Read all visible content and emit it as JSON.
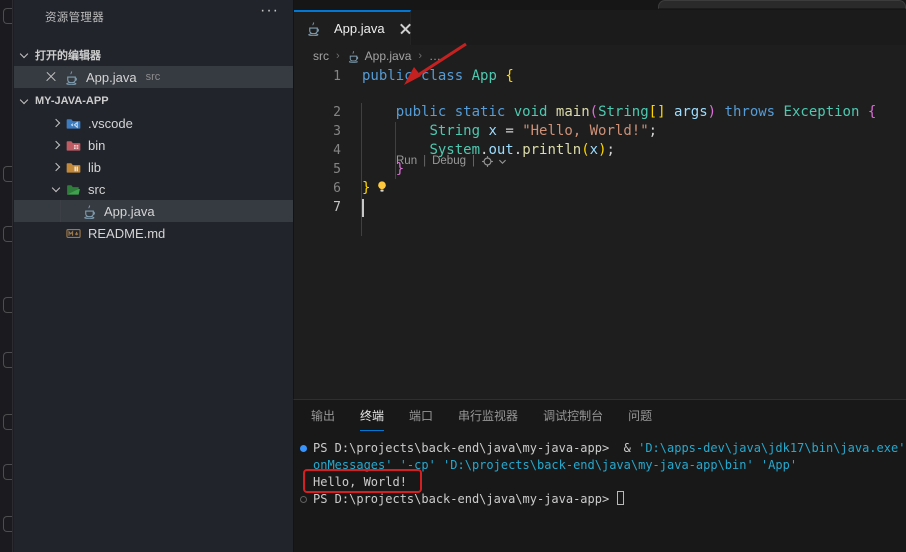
{
  "colors": {
    "accent_blue": "#0078d4",
    "annotation_red": "#d42020",
    "terminal_cyan": "#27a8cd",
    "selection_row": "#363a41"
  },
  "sidebar": {
    "title": "资源管理器",
    "more_icon": "···",
    "open_editors": {
      "label": "打开的编辑器",
      "file": {
        "name": "App.java",
        "detail": "src"
      }
    },
    "project": {
      "label": "MY-JAVA-APP",
      "items": [
        {
          "name": ".vscode",
          "icon": "folder-vscode",
          "chevron": "right",
          "indent": 1,
          "selected": false
        },
        {
          "name": "bin",
          "icon": "folder-bin",
          "chevron": "right",
          "indent": 1,
          "selected": false
        },
        {
          "name": "lib",
          "icon": "folder-lib",
          "chevron": "right",
          "indent": 1,
          "selected": false
        },
        {
          "name": "src",
          "icon": "folder-src",
          "chevron": "down",
          "indent": 1,
          "selected": false
        },
        {
          "name": "App.java",
          "icon": "file-java",
          "chevron": "none",
          "indent": 2,
          "selected": true
        },
        {
          "name": "README.md",
          "icon": "file-markdown",
          "chevron": "none",
          "indent": 1,
          "selected": false
        }
      ]
    }
  },
  "editor": {
    "tab": {
      "label": "App.java"
    },
    "breadcrumb": {
      "items": [
        "src",
        "App.java",
        "…"
      ]
    },
    "codelens": {
      "run_label": "Run",
      "debug_label": "Debug",
      "separator": "|"
    },
    "lines": [
      {
        "num": 1,
        "lens": true,
        "tokens": [
          {
            "t": "public",
            "c": "kw"
          },
          {
            "t": " ",
            "c": "fg"
          },
          {
            "t": "class",
            "c": "kw"
          },
          {
            "t": " ",
            "c": "fg"
          },
          {
            "t": "App",
            "c": "type"
          },
          {
            "t": " ",
            "c": "fg"
          },
          {
            "t": "{",
            "c": "b1"
          }
        ]
      },
      {
        "num": 2,
        "tokens": [
          {
            "t": "    ",
            "c": "fg"
          },
          {
            "t": "public",
            "c": "kw"
          },
          {
            "t": " ",
            "c": "fg"
          },
          {
            "t": "static",
            "c": "kw"
          },
          {
            "t": " ",
            "c": "fg"
          },
          {
            "t": "void",
            "c": "type"
          },
          {
            "t": " ",
            "c": "fg"
          },
          {
            "t": "main",
            "c": "fn"
          },
          {
            "t": "(",
            "c": "b2"
          },
          {
            "t": "String",
            "c": "type"
          },
          {
            "t": "[]",
            "c": "b1"
          },
          {
            "t": " ",
            "c": "fg"
          },
          {
            "t": "args",
            "c": "var"
          },
          {
            "t": ")",
            "c": "b2"
          },
          {
            "t": " ",
            "c": "fg"
          },
          {
            "t": "throws",
            "c": "kw"
          },
          {
            "t": " ",
            "c": "fg"
          },
          {
            "t": "Exception",
            "c": "type"
          },
          {
            "t": " ",
            "c": "fg"
          },
          {
            "t": "{",
            "c": "b2"
          }
        ]
      },
      {
        "num": 3,
        "tokens": [
          {
            "t": "        ",
            "c": "fg"
          },
          {
            "t": "String",
            "c": "type"
          },
          {
            "t": " ",
            "c": "fg"
          },
          {
            "t": "x",
            "c": "var"
          },
          {
            "t": " = ",
            "c": "fg"
          },
          {
            "t": "\"Hello, World!\"",
            "c": "str"
          },
          {
            "t": ";",
            "c": "fg"
          }
        ]
      },
      {
        "num": 4,
        "tokens": [
          {
            "t": "        ",
            "c": "fg"
          },
          {
            "t": "System",
            "c": "type"
          },
          {
            "t": ".",
            "c": "fg"
          },
          {
            "t": "out",
            "c": "var"
          },
          {
            "t": ".",
            "c": "fg"
          },
          {
            "t": "println",
            "c": "fn"
          },
          {
            "t": "(",
            "c": "b1"
          },
          {
            "t": "x",
            "c": "var"
          },
          {
            "t": ")",
            "c": "b1"
          },
          {
            "t": ";",
            "c": "fg"
          }
        ]
      },
      {
        "num": 5,
        "tokens": [
          {
            "t": "    ",
            "c": "fg"
          },
          {
            "t": "}",
            "c": "b2"
          }
        ]
      },
      {
        "num": 6,
        "lightbulb": true,
        "tokens": [
          {
            "t": "}",
            "c": "b1"
          }
        ]
      },
      {
        "num": 7,
        "cursor": true,
        "tokens": []
      }
    ]
  },
  "panel": {
    "tabs": [
      {
        "label": "输出",
        "active": false
      },
      {
        "label": "终端",
        "active": true
      },
      {
        "label": "端口",
        "active": false
      },
      {
        "label": "串行监视器",
        "active": false
      },
      {
        "label": "调试控制台",
        "active": false
      },
      {
        "label": "问题",
        "active": false
      }
    ],
    "terminal": {
      "lines": [
        {
          "decoration": "success",
          "segments": [
            {
              "t": "PS D:\\projects\\back-end\\java\\my-java-app>  & ",
              "c": "fg"
            },
            {
              "t": "'D:\\apps-dev\\java\\jdk17\\bin\\java.exe'",
              "c": "cyan"
            },
            {
              "t": " ",
              "c": "fg"
            },
            {
              "t": "'-",
              "c": "cyan"
            }
          ]
        },
        {
          "segments": [
            {
              "t": "onMessages' '-cp' 'D:\\projects\\back-end\\java\\my-java-app\\bin' 'App'",
              "c": "cyan"
            }
          ]
        },
        {
          "highlight": true,
          "segments": [
            {
              "t": "Hello, World!",
              "c": "fg"
            }
          ]
        },
        {
          "decoration": "pending",
          "cursor": true,
          "segments": [
            {
              "t": "PS D:\\projects\\back-end\\java\\my-java-app> ",
              "c": "fg"
            }
          ]
        }
      ]
    }
  }
}
